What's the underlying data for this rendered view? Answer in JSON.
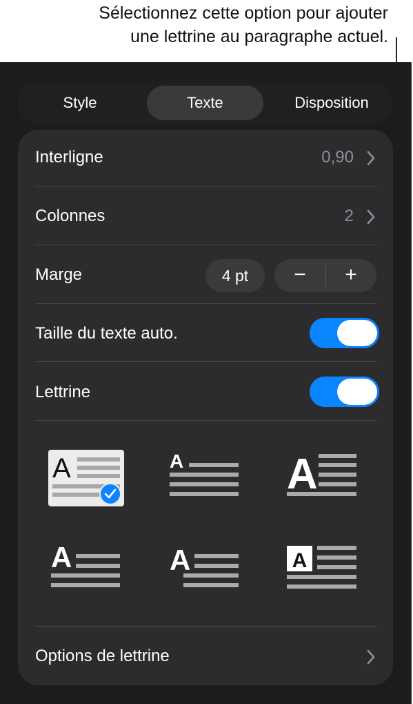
{
  "callout": {
    "line1": "Sélectionnez cette option pour ajouter",
    "line2": "une lettrine au paragraphe actuel."
  },
  "tabs": [
    {
      "label": "Style",
      "active": false
    },
    {
      "label": "Texte",
      "active": true
    },
    {
      "label": "Disposition",
      "active": false
    }
  ],
  "rows": {
    "interligne": {
      "label": "Interligne",
      "value": "0,90"
    },
    "colonnes": {
      "label": "Colonnes",
      "value": "2"
    },
    "marge": {
      "label": "Marge",
      "value": "4 pt",
      "minus": "−",
      "plus": "+"
    },
    "taille_auto": {
      "label": "Taille du texte auto.",
      "on": true
    },
    "lettrine": {
      "label": "Lettrine",
      "on": true
    },
    "options": {
      "label": "Options de lettrine"
    }
  },
  "drop_cap_styles": {
    "letter": "A",
    "selected_index": 0
  },
  "colors": {
    "accent": "#0a84ff",
    "panel": "#1c1c1e",
    "card": "#2c2c2e"
  }
}
